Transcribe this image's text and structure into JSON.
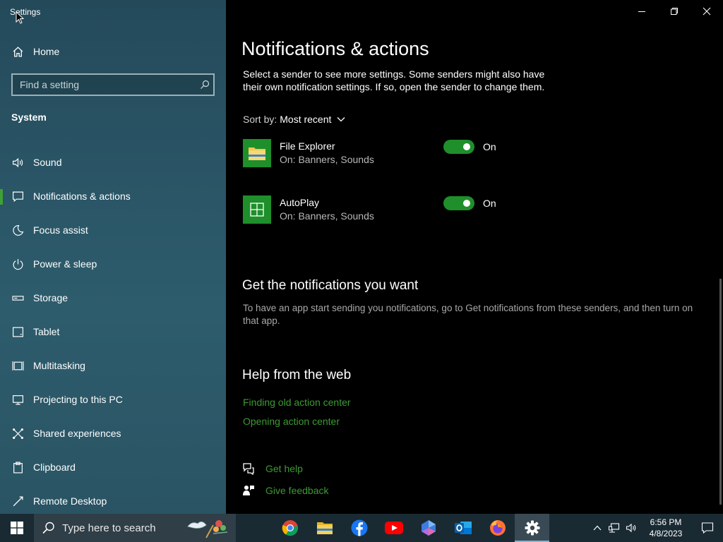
{
  "window": {
    "title": "Settings",
    "controls": [
      "minimize",
      "maximize",
      "close"
    ]
  },
  "sidebar": {
    "home_label": "Home",
    "search_placeholder": "Find a setting",
    "section_heading": "System",
    "items": [
      {
        "label": "Sound",
        "icon": "speaker-icon"
      },
      {
        "label": "Notifications & actions",
        "icon": "notification-icon",
        "selected": true
      },
      {
        "label": "Focus assist",
        "icon": "moon-icon"
      },
      {
        "label": "Power & sleep",
        "icon": "power-icon"
      },
      {
        "label": "Storage",
        "icon": "storage-icon"
      },
      {
        "label": "Tablet",
        "icon": "tablet-icon"
      },
      {
        "label": "Multitasking",
        "icon": "multitasking-icon"
      },
      {
        "label": "Projecting to this PC",
        "icon": "projecting-icon"
      },
      {
        "label": "Shared experiences",
        "icon": "shared-experiences-icon"
      },
      {
        "label": "Clipboard",
        "icon": "clipboard-icon"
      },
      {
        "label": "Remote Desktop",
        "icon": "remote-desktop-icon"
      }
    ]
  },
  "main": {
    "title": "Notifications & actions",
    "description": "Select a sender to see more settings. Some senders might also have their own notification settings. If so, open the sender to change them.",
    "sort_label": "Sort by:",
    "sort_value": "Most recent",
    "senders": [
      {
        "name": "File Explorer",
        "status": "On: Banners, Sounds",
        "toggle_label": "On",
        "enabled": true,
        "icon": "file-explorer-icon"
      },
      {
        "name": "AutoPlay",
        "status": "On: Banners, Sounds",
        "toggle_label": "On",
        "enabled": true,
        "icon": "autoplay-icon"
      }
    ],
    "get_notifications_heading": "Get the notifications you want",
    "get_notifications_text": "To have an app start sending you notifications, go to Get notifications from these senders, and then turn on that app.",
    "help_heading": "Help from the web",
    "help_links": [
      "Finding old action center",
      "Opening action center"
    ],
    "get_help": "Get help",
    "give_feedback": "Give feedback",
    "link_color": "#3c9b33",
    "accent_color": "#1e8f2a"
  },
  "taskbar": {
    "search_placeholder": "Type here to search",
    "pinned": [
      "chrome-icon",
      "file-explorer-icon",
      "facebook-icon",
      "youtube-icon",
      "copilot-icon",
      "outlook-icon",
      "firefox-icon",
      "settings-icon"
    ],
    "time": "6:56 PM",
    "date": "4/8/2023"
  }
}
